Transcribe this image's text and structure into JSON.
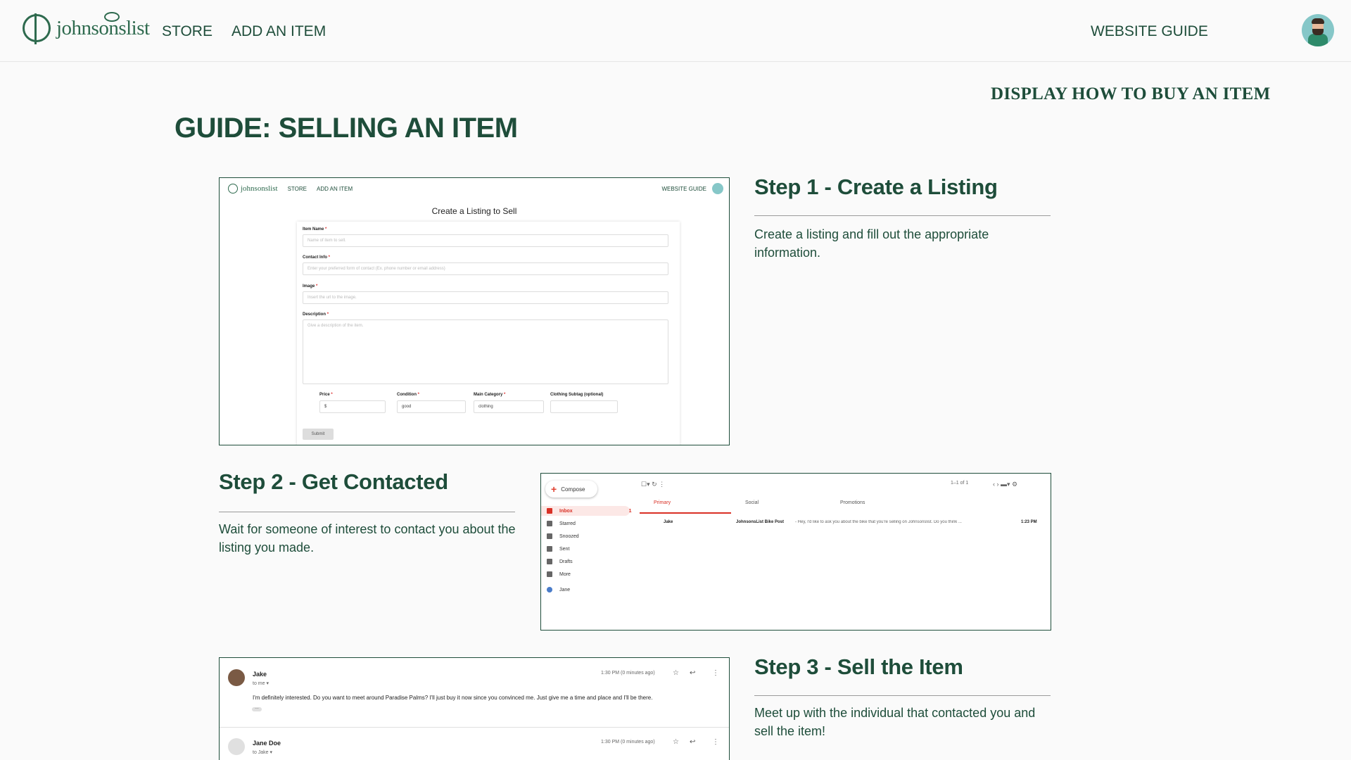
{
  "nav": {
    "brand": "johnsonslist",
    "store": "STORE",
    "add_item": "ADD AN ITEM",
    "guide": "WEBSITE GUIDE"
  },
  "header": {
    "toggle": "DISPLAY HOW TO BUY AN ITEM",
    "title": "GUIDE: SELLING AN ITEM"
  },
  "steps": [
    {
      "heading": "Step 1 - Create a Listing",
      "text": "Create a listing and fill out the appropriate information."
    },
    {
      "heading": "Step 2 - Get Contacted",
      "text": "Wait for someone of interest to contact you about the listing you made."
    },
    {
      "heading": "Step 3 - Sell the Item",
      "text": "Meet up with the individual that contacted you and sell the item!"
    }
  ],
  "shot1": {
    "brand": "johnsonslist",
    "store": "STORE",
    "add_item": "ADD AN ITEM",
    "guide": "WEBSITE GUIDE",
    "title": "Create a Listing to Sell",
    "item_name_label": "Item Name",
    "item_name_ph": "Name of item to sell.",
    "contact_label": "Contact Info",
    "contact_ph": "Enter your preferred form of contact (Ex. phone number or email address)",
    "image_label": "Image",
    "image_ph": "Insert the url to the image.",
    "desc_label": "Description",
    "desc_ph": "Give a description of the item.",
    "price_label": "Price",
    "price_val": "$",
    "condition_label": "Condition",
    "condition_val": "good",
    "category_label": "Main Category",
    "category_val": "clothing",
    "subtag_label": "Clothing Subtag (optional)",
    "required_mark": "*",
    "submit": "Submit"
  },
  "shot2": {
    "compose": "Compose",
    "sidebar": [
      "Inbox",
      "Starred",
      "Snoozed",
      "Sent",
      "Drafts",
      "More"
    ],
    "inbox_count": "1",
    "account": "Jane",
    "pagination": "1–1 of 1",
    "tabs": [
      "Primary",
      "Social",
      "Promotions"
    ],
    "mail_from": "Jake",
    "mail_subject": "JohnsonsList Bike Post",
    "mail_snippet": "- Hey, I'd like to ask you about the bike that you're selling on Johnsonslist. Do you think ...",
    "mail_time": "1:23 PM"
  },
  "shot3": {
    "msg1_name": "Jake",
    "msg1_to": "to me ▾",
    "msg1_time": "1:30 PM (0 minutes ago)",
    "msg1_body": "I'm definitely interested. Do you want to meet around Paradise Palms? I'll just buy it now since you convinced me. Just give me a time and place and I'll be there.",
    "msg2_name": "Jane Doe",
    "msg2_to": "to Jake ▾",
    "msg2_time": "1:30 PM (0 minutes ago)"
  },
  "colors": {
    "brand_green": "#1e4d3a",
    "gmail_red": "#d93025"
  }
}
